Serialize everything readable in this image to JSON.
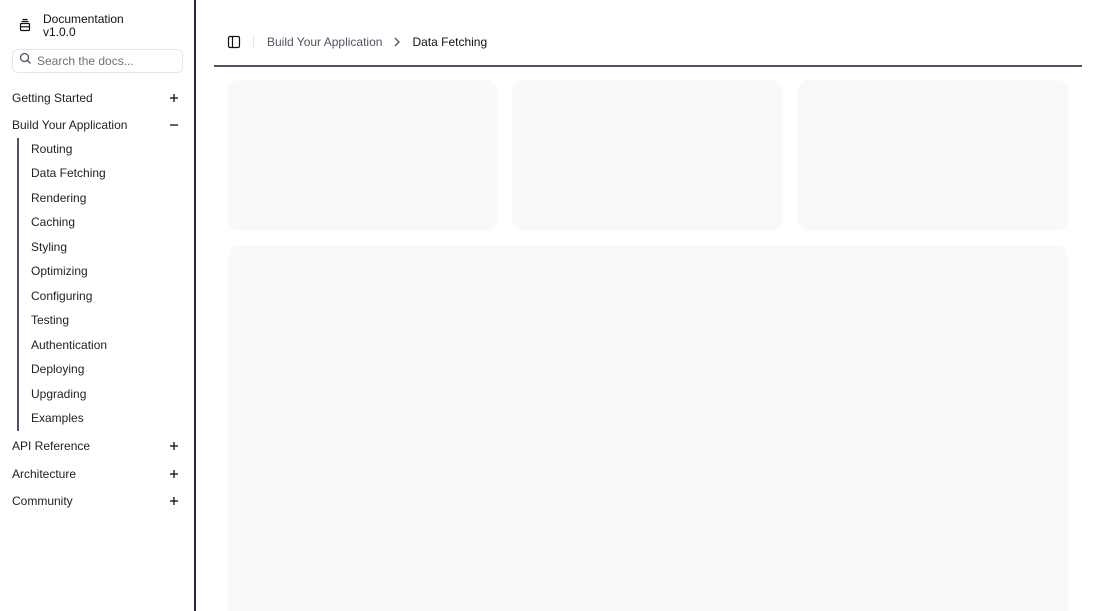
{
  "brand": {
    "title": "Documentation",
    "version": "v1.0.0",
    "icon": "gallery-icon"
  },
  "search": {
    "placeholder": "Search the docs..."
  },
  "sidebar": {
    "groups": [
      {
        "label": "Getting Started",
        "state": "collapsed",
        "toggle_icon": "plus-icon"
      },
      {
        "label": "Build Your Application",
        "state": "expanded",
        "toggle_icon": "minus-icon"
      },
      {
        "label": "API Reference",
        "state": "collapsed",
        "toggle_icon": "plus-icon"
      },
      {
        "label": "Architecture",
        "state": "collapsed",
        "toggle_icon": "plus-icon"
      },
      {
        "label": "Community",
        "state": "collapsed",
        "toggle_icon": "plus-icon"
      }
    ],
    "subitems": [
      {
        "label": "Routing"
      },
      {
        "label": "Data Fetching"
      },
      {
        "label": "Rendering"
      },
      {
        "label": "Caching"
      },
      {
        "label": "Styling"
      },
      {
        "label": "Optimizing"
      },
      {
        "label": "Configuring"
      },
      {
        "label": "Testing"
      },
      {
        "label": "Authentication"
      },
      {
        "label": "Deploying"
      },
      {
        "label": "Upgrading"
      },
      {
        "label": "Examples"
      }
    ]
  },
  "header": {
    "toggle_icon": "sidebar-toggle-icon",
    "breadcrumb": {
      "parent": "Build Your Application",
      "current": "Data Fetching",
      "separator_icon": "chevron-right-icon"
    }
  },
  "colors": {
    "skeleton": "#f9f9fa",
    "divider": "#4b5563",
    "sidebar_border": "#1f2937"
  }
}
